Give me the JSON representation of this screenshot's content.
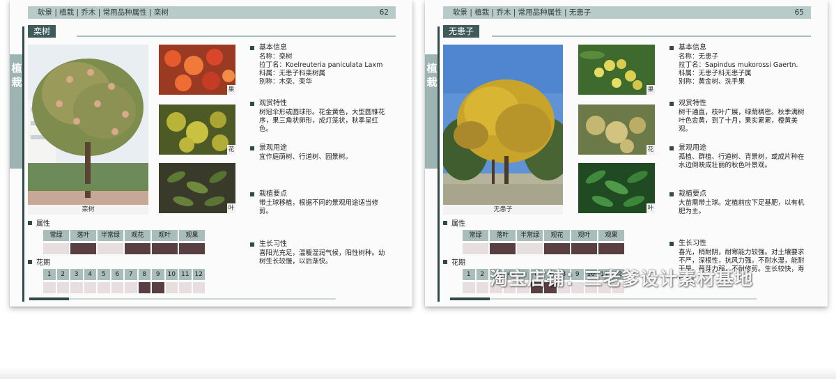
{
  "pages": [
    {
      "breadcrumb": "软景 | 植栽 | 乔木 | 常用品种属性 | 栾树",
      "page_number": "62",
      "side_label": "植栽",
      "title": "栾树",
      "photo_caption": "栾树",
      "thumb_tags": [
        "果",
        "花",
        "叶"
      ],
      "sections": [
        {
          "heading": "基本信息",
          "lines": [
            "名称：栾树",
            "拉丁名：Koelreuteria paniculata Laxm",
            "科属：无患子科栾树属",
            "别称：木栾、栾华"
          ]
        },
        {
          "heading": "观赏特性",
          "lines": [
            "树冠伞形或圆球形。花金黄色，大型圆锥花序，果三角状卵形，成灯笼状，秋季呈红色。"
          ]
        },
        {
          "heading": "景观用途",
          "lines": [
            "宜作庭荫树、行道树、园景树。"
          ]
        },
        {
          "heading": "栽植要点",
          "lines": [
            "带土球移植，根据不同的景观用途适当修剪。"
          ]
        },
        {
          "heading": "生长习性",
          "lines": [
            "喜阳光充足，温暖湿润气候，阳性树种。幼树生长较慢，以后渐快。"
          ]
        }
      ],
      "attribute_label": "属性",
      "attribute_headers": [
        "常绿",
        "落叶",
        "半常绿",
        "观花",
        "观叶",
        "观果"
      ],
      "attribute_values": [
        false,
        true,
        false,
        true,
        true,
        true
      ],
      "flowering_label": "花期",
      "months": [
        "1",
        "2",
        "3",
        "4",
        "5",
        "6",
        "7",
        "8",
        "9",
        "10",
        "11",
        "12"
      ],
      "flowering": [
        false,
        false,
        false,
        false,
        false,
        false,
        false,
        true,
        true,
        false,
        false,
        false
      ],
      "progress": 0.13
    },
    {
      "breadcrumb": "软景 | 植栽 | 乔木 | 常用品种属性 | 无患子",
      "page_number": "65",
      "side_label": "植栽",
      "title": "无患子",
      "photo_caption": "无患子",
      "thumb_tags": [
        "果",
        "花",
        "叶"
      ],
      "sections": [
        {
          "heading": "基本信息",
          "lines": [
            "名称：无患子",
            "拉丁名：Sapindus mukorossi Gaertn.",
            "科属：无患子科无患子属",
            "别称：黄金树、洗手果"
          ]
        },
        {
          "heading": "观赏特性",
          "lines": [
            "树干通直，枝叶广展，绿荫稠密。秋季满树叶色金黄，到了十月，果实累累，橙黄美观。"
          ]
        },
        {
          "heading": "景观用途",
          "lines": [
            "孤植、群植、行道树、背景树，或成片种在水边倒映成壮丽的秋色叶景观。"
          ]
        },
        {
          "heading": "栽植要点",
          "lines": [
            "大苗需带土球。定植前应下足基肥，以有机肥为主。"
          ]
        },
        {
          "heading": "生长习性",
          "lines": [
            "喜光，稍耐阴，耐寒能力较强。对土壤要求不严，深根性，抗风力强。不耐水湿，能耐干旱。萌芽力弱，不耐修剪。生长较快，寿命长。"
          ]
        }
      ],
      "attribute_label": "属性",
      "attribute_headers": [
        "常绿",
        "落叶",
        "半常绿",
        "观花",
        "观叶",
        "观果"
      ],
      "attribute_values": [
        false,
        true,
        false,
        true,
        true,
        true
      ],
      "flowering_label": "花期",
      "months": [
        "1",
        "2",
        "3",
        "4",
        "5",
        "6",
        "7",
        "8",
        "9",
        "10",
        "11",
        "12"
      ],
      "flowering": [
        false,
        false,
        false,
        false,
        false,
        true,
        true,
        false,
        false,
        false,
        false,
        false
      ],
      "progress": 0.13
    }
  ],
  "watermark": "淘宝店铺：三老爹设计素材基地",
  "colors": {
    "accent": "#2f4a48",
    "header_bar": "#b9cbc9",
    "cell_on": "#5a3f42",
    "cell_off": "#e7dfdf"
  }
}
